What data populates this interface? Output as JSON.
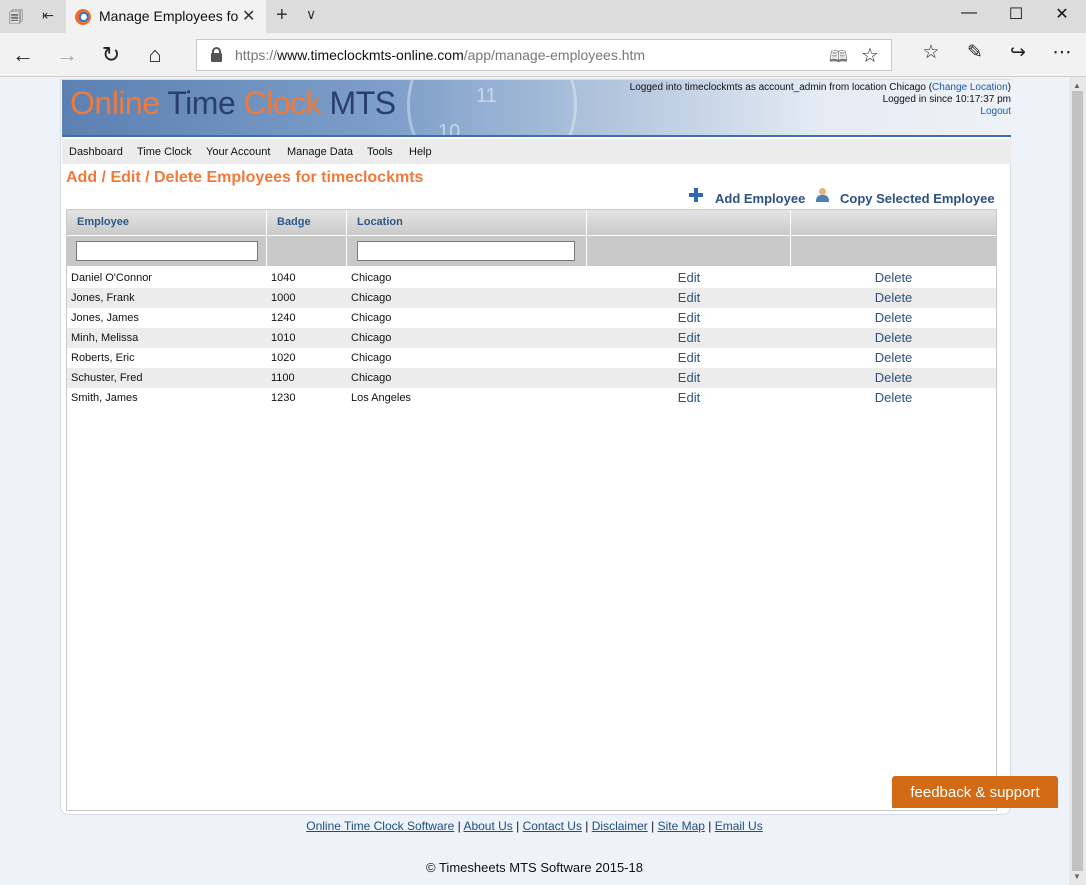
{
  "browser": {
    "tab_title": "Manage Employees for",
    "url_prefix": "https://",
    "url_host": "www.timeclockmts-online.com",
    "url_path": "/app/manage-employees.htm"
  },
  "header": {
    "logo": {
      "w1": "Online",
      "w2": "Time",
      "w3": "Clock",
      "w4": "MTS"
    },
    "session_line1": "Logged into timeclockmts as account_admin from location Chicago (",
    "change_location": "Change Location",
    "session_close": ")",
    "session_line2": "Logged in since 10:17:37 pm",
    "logout": "Logout"
  },
  "menu": [
    "Dashboard",
    "Time Clock",
    "Your Account",
    "Manage Data",
    "Tools",
    "Help"
  ],
  "page_title": "Add / Edit / Delete Employees for timeclockmts",
  "actions": {
    "add": "Add Employee",
    "copy": "Copy Selected Employee"
  },
  "table": {
    "columns": [
      "Employee",
      "Badge",
      "Location",
      "",
      ""
    ],
    "filters": {
      "employee": "",
      "location": ""
    },
    "edit_label": "Edit",
    "delete_label": "Delete",
    "rows": [
      {
        "employee": "Daniel O'Connor",
        "badge": "1040",
        "location": "Chicago"
      },
      {
        "employee": "Jones, Frank",
        "badge": "1000",
        "location": "Chicago"
      },
      {
        "employee": "Jones, James",
        "badge": "1240",
        "location": "Chicago"
      },
      {
        "employee": "Minh, Melissa",
        "badge": "1010",
        "location": "Chicago"
      },
      {
        "employee": "Roberts, Eric",
        "badge": "1020",
        "location": "Chicago"
      },
      {
        "employee": "Schuster, Fred",
        "badge": "1100",
        "location": "Chicago"
      },
      {
        "employee": "Smith, James",
        "badge": "1230",
        "location": "Los Angeles"
      }
    ]
  },
  "footer": {
    "links": [
      "Online Time Clock Software",
      "About Us",
      "Contact Us",
      "Disclaimer",
      "Site Map",
      "Email Us"
    ],
    "separator": " | ",
    "copyright": "© Timesheets MTS Software 2015-18"
  },
  "feedback_label": "feedback & support",
  "colors": {
    "accent": "#f07a3a",
    "link": "#2c5182",
    "feedback": "#d26a16"
  }
}
